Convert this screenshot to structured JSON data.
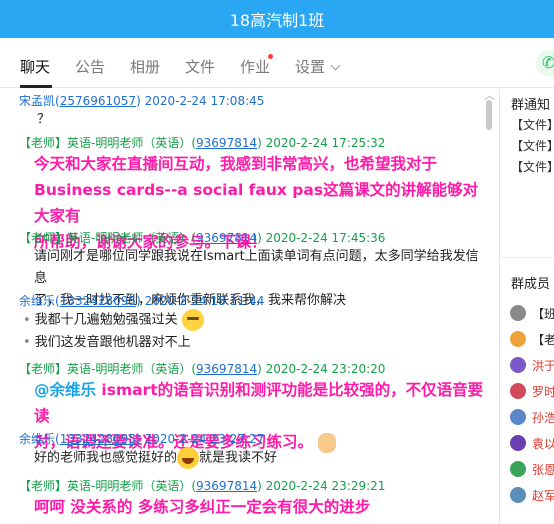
{
  "window": {
    "title": "18高汽制1班"
  },
  "tabs": {
    "items": [
      {
        "label": "聊天"
      },
      {
        "label": "公告"
      },
      {
        "label": "相册"
      },
      {
        "label": "文件"
      },
      {
        "label": "作业"
      },
      {
        "label": "设置"
      }
    ],
    "active": "聊天"
  },
  "messages": [
    {
      "sender": "宋孟凯",
      "qq": "2576961057",
      "time": "2020-2-24 17:08:45",
      "lines": [
        "？"
      ]
    },
    {
      "sender": "【老师】英语-明明老师（英语）",
      "qq": "93697814",
      "time": "2020-2-24 17:25:32",
      "lines": [
        "今天和大家在直播间互动，我感到非常高兴，也希望我对于",
        "Business cards--a social faux pas这篇课文的讲解能够对大家有",
        "所帮助，谢谢大家的参与。下课！"
      ]
    },
    {
      "sender": "【老师】英语-明明老师（英语）",
      "qq": "93697814",
      "time": "2020-2-24 17:45:36",
      "lines": [
        "请问刚才是哪位同学跟我说在Ismart上面读单词有点问题，太多同学给我发信息",
        "了，我一时找不到，麻烦你重新联系我，我来帮你解决"
      ]
    },
    {
      "sender": "余维乐",
      "qq": "1332428095",
      "time": "2020-2-24 18:11:44",
      "lines": [
        "我都十几遍勉勉强强过关",
        "我们这发音跟他机器对不上"
      ]
    },
    {
      "sender": "【老师】英语-明明老师（英语）",
      "qq": "93697814",
      "time": "2020-2-24 23:20:20",
      "mention": "@余维乐",
      "lines": [
        " ismart的语音识别和测评功能是比较强的，不仅语音要读",
        "对，语调还要读准。还是要多练习练习。"
      ]
    },
    {
      "sender": "余维乐",
      "qq": "1332428095",
      "time": "2020-2-24 23:27:27",
      "lines": [
        "好的老师我也感觉挺好的",
        "就是我读不好"
      ]
    },
    {
      "sender": "【老师】英语-明明老师（英语）",
      "qq": "93697814",
      "time": "2020-2-24 23:29:21",
      "lines": [
        "呵呵 没关系的 多练习多纠正一定会有很大的进步"
      ]
    }
  ],
  "right_panel": {
    "notice_title": "群通知",
    "files": [
      "【文件】",
      "【文件】",
      "【文件】"
    ],
    "members_title": "群成员",
    "members": [
      {
        "name": "【班",
        "color": "#222222"
      },
      {
        "name": "【老",
        "color": "#222222"
      },
      {
        "name": "洪于",
        "color": "#e0352b"
      },
      {
        "name": "罗时",
        "color": "#e0352b"
      },
      {
        "name": "孙浩",
        "color": "#e0352b"
      },
      {
        "name": "袁以",
        "color": "#e0352b"
      },
      {
        "name": "张恩",
        "color": "#e0352b"
      },
      {
        "name": "赵军",
        "color": "#e0352b"
      }
    ]
  },
  "colors": {
    "title_bar": "#2aa7f2",
    "teacher_highlight": "#ff1aa8",
    "teacher_name": "#16a04a",
    "student_name": "#1e6fd2",
    "mention": "#1aa4e6"
  },
  "icons": {
    "settings_dropdown": "chevron-down-icon",
    "call": "phone-icon",
    "scroll_up": "chevron-up-icon"
  }
}
